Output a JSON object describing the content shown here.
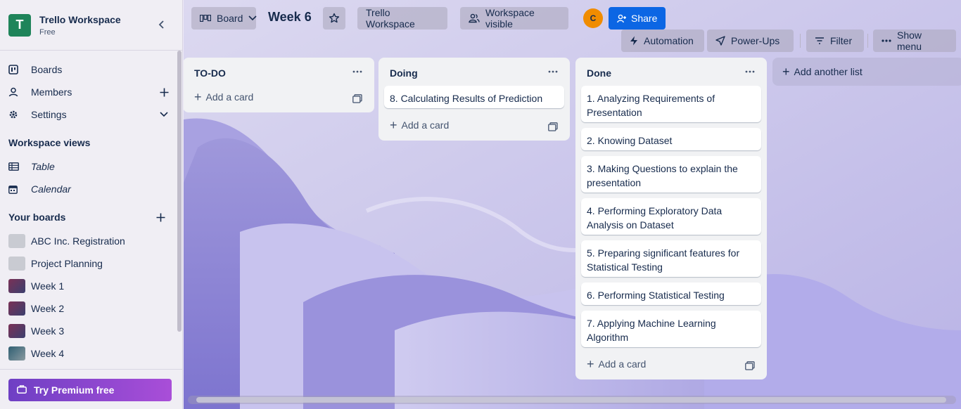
{
  "workspace": {
    "initial": "T",
    "name": "Trello Workspace",
    "plan": "Free"
  },
  "sidebar": {
    "nav": [
      {
        "label": "Boards",
        "icon": "boards-icon"
      },
      {
        "label": "Members",
        "icon": "members-icon"
      },
      {
        "label": "Settings",
        "icon": "settings-icon"
      }
    ],
    "views_heading": "Workspace views",
    "views": [
      {
        "label": "Table",
        "icon": "table-icon"
      },
      {
        "label": "Calendar",
        "icon": "calendar-icon"
      }
    ],
    "boards_heading": "Your boards",
    "boards": [
      {
        "label": "ABC Inc. Registration",
        "thumb_color": "#c9cbd2"
      },
      {
        "label": "Project Planning",
        "thumb_color": "#c9cbd2"
      },
      {
        "label": "Week 1",
        "thumb_color": "#6b3a5e"
      },
      {
        "label": "Week 2",
        "thumb_color": "#6b3a5e"
      },
      {
        "label": "Week 3",
        "thumb_color": "#6b3a5e"
      },
      {
        "label": "Week 4",
        "thumb_color": "#3e6b7a"
      }
    ],
    "premium_label": "Try Premium free"
  },
  "header": {
    "view_label": "Board",
    "board_title": "Week 6",
    "workspace_label": "Trello Workspace",
    "visibility_label": "Workspace visible",
    "avatar_initial": "C",
    "share_label": "Share",
    "automation_label": "Automation",
    "powerups_label": "Power-Ups",
    "filter_label": "Filter",
    "show_menu_label": "Show menu"
  },
  "lists": [
    {
      "title": "TO-DO",
      "cards": [],
      "add_card_label": "Add a card"
    },
    {
      "title": "Doing",
      "cards": [
        "8. Calculating Results of Prediction"
      ],
      "add_card_label": "Add a card"
    },
    {
      "title": "Done",
      "cards": [
        "1. Analyzing Requirements of Presentation",
        "2. Knowing Dataset",
        "3. Making Questions to explain the presentation",
        "4. Performing Exploratory Data Analysis on Dataset",
        "5. Preparing significant features for Statistical Testing",
        "6. Performing Statistical Testing",
        "7. Applying Machine Learning Algorithm"
      ],
      "add_card_label": "Add a card"
    }
  ],
  "add_list_label": "Add another list",
  "colors": {
    "accent": "#0c66e4",
    "workspace_logo": "#1f845a",
    "premium": "#8a46cf"
  }
}
